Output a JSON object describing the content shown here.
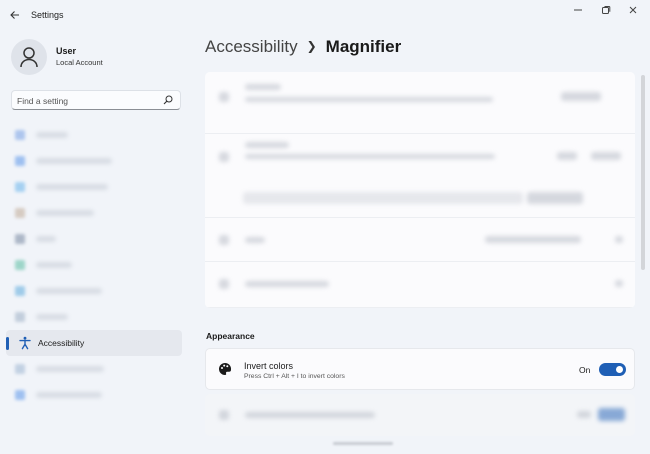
{
  "window": {
    "title": "Settings"
  },
  "user": {
    "name": "User",
    "account": "Local Account"
  },
  "search": {
    "placeholder": "Find a setting"
  },
  "sidebar": {
    "active_item": "Accessibility"
  },
  "header": {
    "section": "Accessibility",
    "page": "Magnifier"
  },
  "appearance": {
    "title": "Appearance",
    "invert_colors": {
      "label": "Invert colors",
      "description": "Press Ctrl + Alt + I to invert colors",
      "state_label": "On",
      "enabled": true
    }
  },
  "colors": {
    "accent": "#1f5fb5",
    "background": "#f1f4f9"
  },
  "icons": {
    "back": "back-arrow-icon",
    "search": "search-icon",
    "accessibility": "accessibility-icon",
    "invert": "palette-icon"
  }
}
